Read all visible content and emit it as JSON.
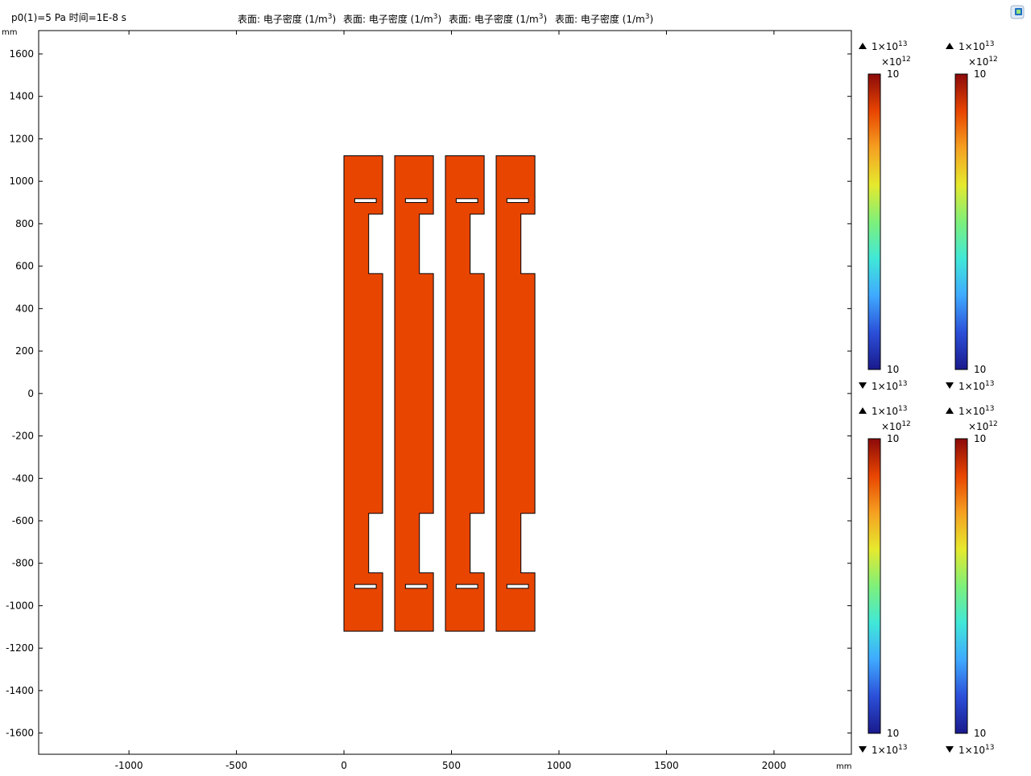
{
  "header": {
    "run_info": "p0(1)=5 Pa 时间=1E-8 s",
    "titles": [
      {
        "prefix": "表面: 电子密度 (1/m",
        "exp": "3",
        "suffix": ")"
      },
      {
        "prefix": "表面: 电子密度 (1/m",
        "exp": "3",
        "suffix": ")"
      },
      {
        "prefix": "表面: 电子密度 (1/m",
        "exp": "3",
        "suffix": ")"
      },
      {
        "prefix": "表面: 电子密度 (1/m",
        "exp": "3",
        "suffix": ")"
      }
    ]
  },
  "toolbar": {
    "icon": "plot-export-icon"
  },
  "chart_data": {
    "type": "heatmap",
    "x_unit_label": "mm",
    "y_unit_label": "mm",
    "xlim": [
      -1420,
      2360
    ],
    "ylim": [
      -1700,
      1710
    ],
    "x_ticks": [
      -1000,
      -500,
      0,
      500,
      1000,
      1500,
      2000
    ],
    "y_ticks": [
      1600,
      1400,
      1200,
      1000,
      800,
      600,
      400,
      200,
      0,
      -200,
      -400,
      -600,
      -800,
      -1000,
      -1200,
      -1400,
      -1600
    ],
    "fill_color": "#e84500",
    "electrodes": [
      {
        "x0": 0,
        "x1": 180,
        "notch_x": 115,
        "notch_side": "right"
      },
      {
        "x0": 236,
        "x1": 416,
        "notch_x": 351,
        "notch_side": "right"
      },
      {
        "x0": 472,
        "x1": 652,
        "notch_x": 587,
        "notch_side": "right"
      },
      {
        "x0": 708,
        "x1": 888,
        "notch_x": 823,
        "notch_side": "right"
      }
    ],
    "electrode_y": {
      "top": 1120,
      "bottom": -1120,
      "notch_top": [
        845,
        565
      ],
      "notch_bottom": [
        -565,
        -845
      ],
      "slot_top_y": [
        900,
        918
      ],
      "slot_bottom_y": [
        -918,
        -900
      ],
      "slot_x_offset": [
        50,
        150
      ]
    },
    "colorbars": [
      {
        "max_label": "1×10",
        "max_exp": "13",
        "multiplier": "×10",
        "multiplier_exp": "12",
        "top_tick": "10",
        "bottom_tick": "10",
        "min_label": "1×10",
        "min_exp": "13"
      },
      {
        "max_label": "1×10",
        "max_exp": "13",
        "multiplier": "×10",
        "multiplier_exp": "12",
        "top_tick": "10",
        "bottom_tick": "10",
        "min_label": "1×10",
        "min_exp": "13"
      },
      {
        "max_label": "1×10",
        "max_exp": "13",
        "multiplier": "×10",
        "multiplier_exp": "12",
        "top_tick": "10",
        "bottom_tick": "10",
        "min_label": "1×10",
        "min_exp": "13"
      },
      {
        "max_label": "1×10",
        "max_exp": "13",
        "multiplier": "×10",
        "multiplier_exp": "12",
        "top_tick": "10",
        "bottom_tick": "10",
        "min_label": "1×10",
        "min_exp": "13"
      }
    ],
    "colormap": [
      "#1a1a8c",
      "#2b4fd8",
      "#3fa9ff",
      "#40e8d8",
      "#7ef07a",
      "#e6e92e",
      "#f5a021",
      "#e84500",
      "#8b0a0a"
    ]
  }
}
